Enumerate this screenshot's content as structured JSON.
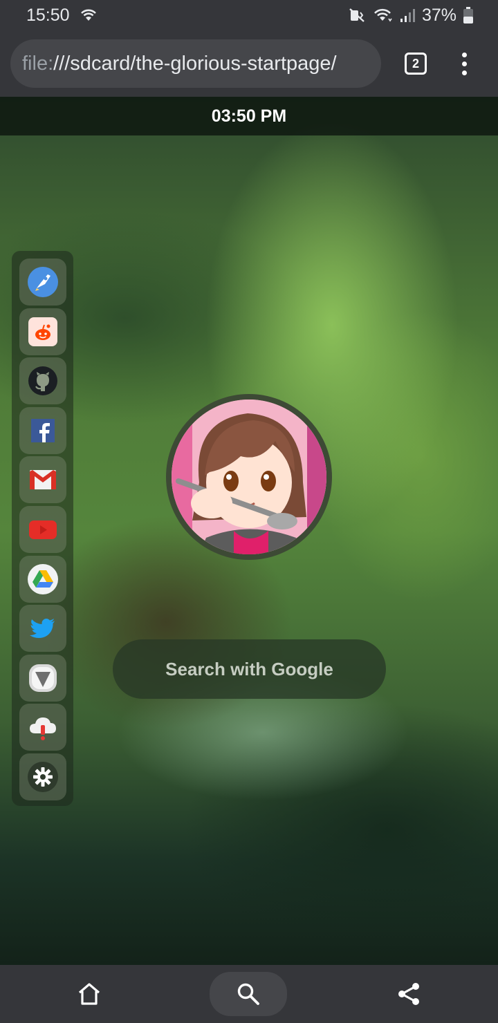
{
  "status_bar": {
    "time": "15:50",
    "battery": "37%",
    "icons": [
      "wifi-icon",
      "mute-icon",
      "wifi-signal-icon",
      "cellular-signal-icon",
      "battery-icon"
    ]
  },
  "toolbar": {
    "url_scheme": "file:",
    "url_rest": "///sdcard/the-glorious-startpage/",
    "tab_count": "2"
  },
  "page": {
    "clock": "03:50 PM",
    "search_placeholder": "Search with Google",
    "dock": [
      {
        "name": "rocket-icon"
      },
      {
        "name": "reddit-icon"
      },
      {
        "name": "github-icon"
      },
      {
        "name": "facebook-icon"
      },
      {
        "name": "gmail-icon"
      },
      {
        "name": "youtube-icon"
      },
      {
        "name": "google-drive-icon"
      },
      {
        "name": "twitter-icon"
      },
      {
        "name": "vivaldi-icon"
      },
      {
        "name": "cloud-alert-icon"
      },
      {
        "name": "settings-gear-icon"
      }
    ]
  },
  "bottom_bar": {
    "icons": [
      "home-icon",
      "search-icon",
      "share-icon"
    ]
  },
  "colors": {
    "browser_chrome": "#35363a",
    "omnibox": "#45464a",
    "reddit": "#ff4500",
    "facebook": "#3b5998",
    "youtube": "#ff0000",
    "twitter": "#1da1f2"
  }
}
